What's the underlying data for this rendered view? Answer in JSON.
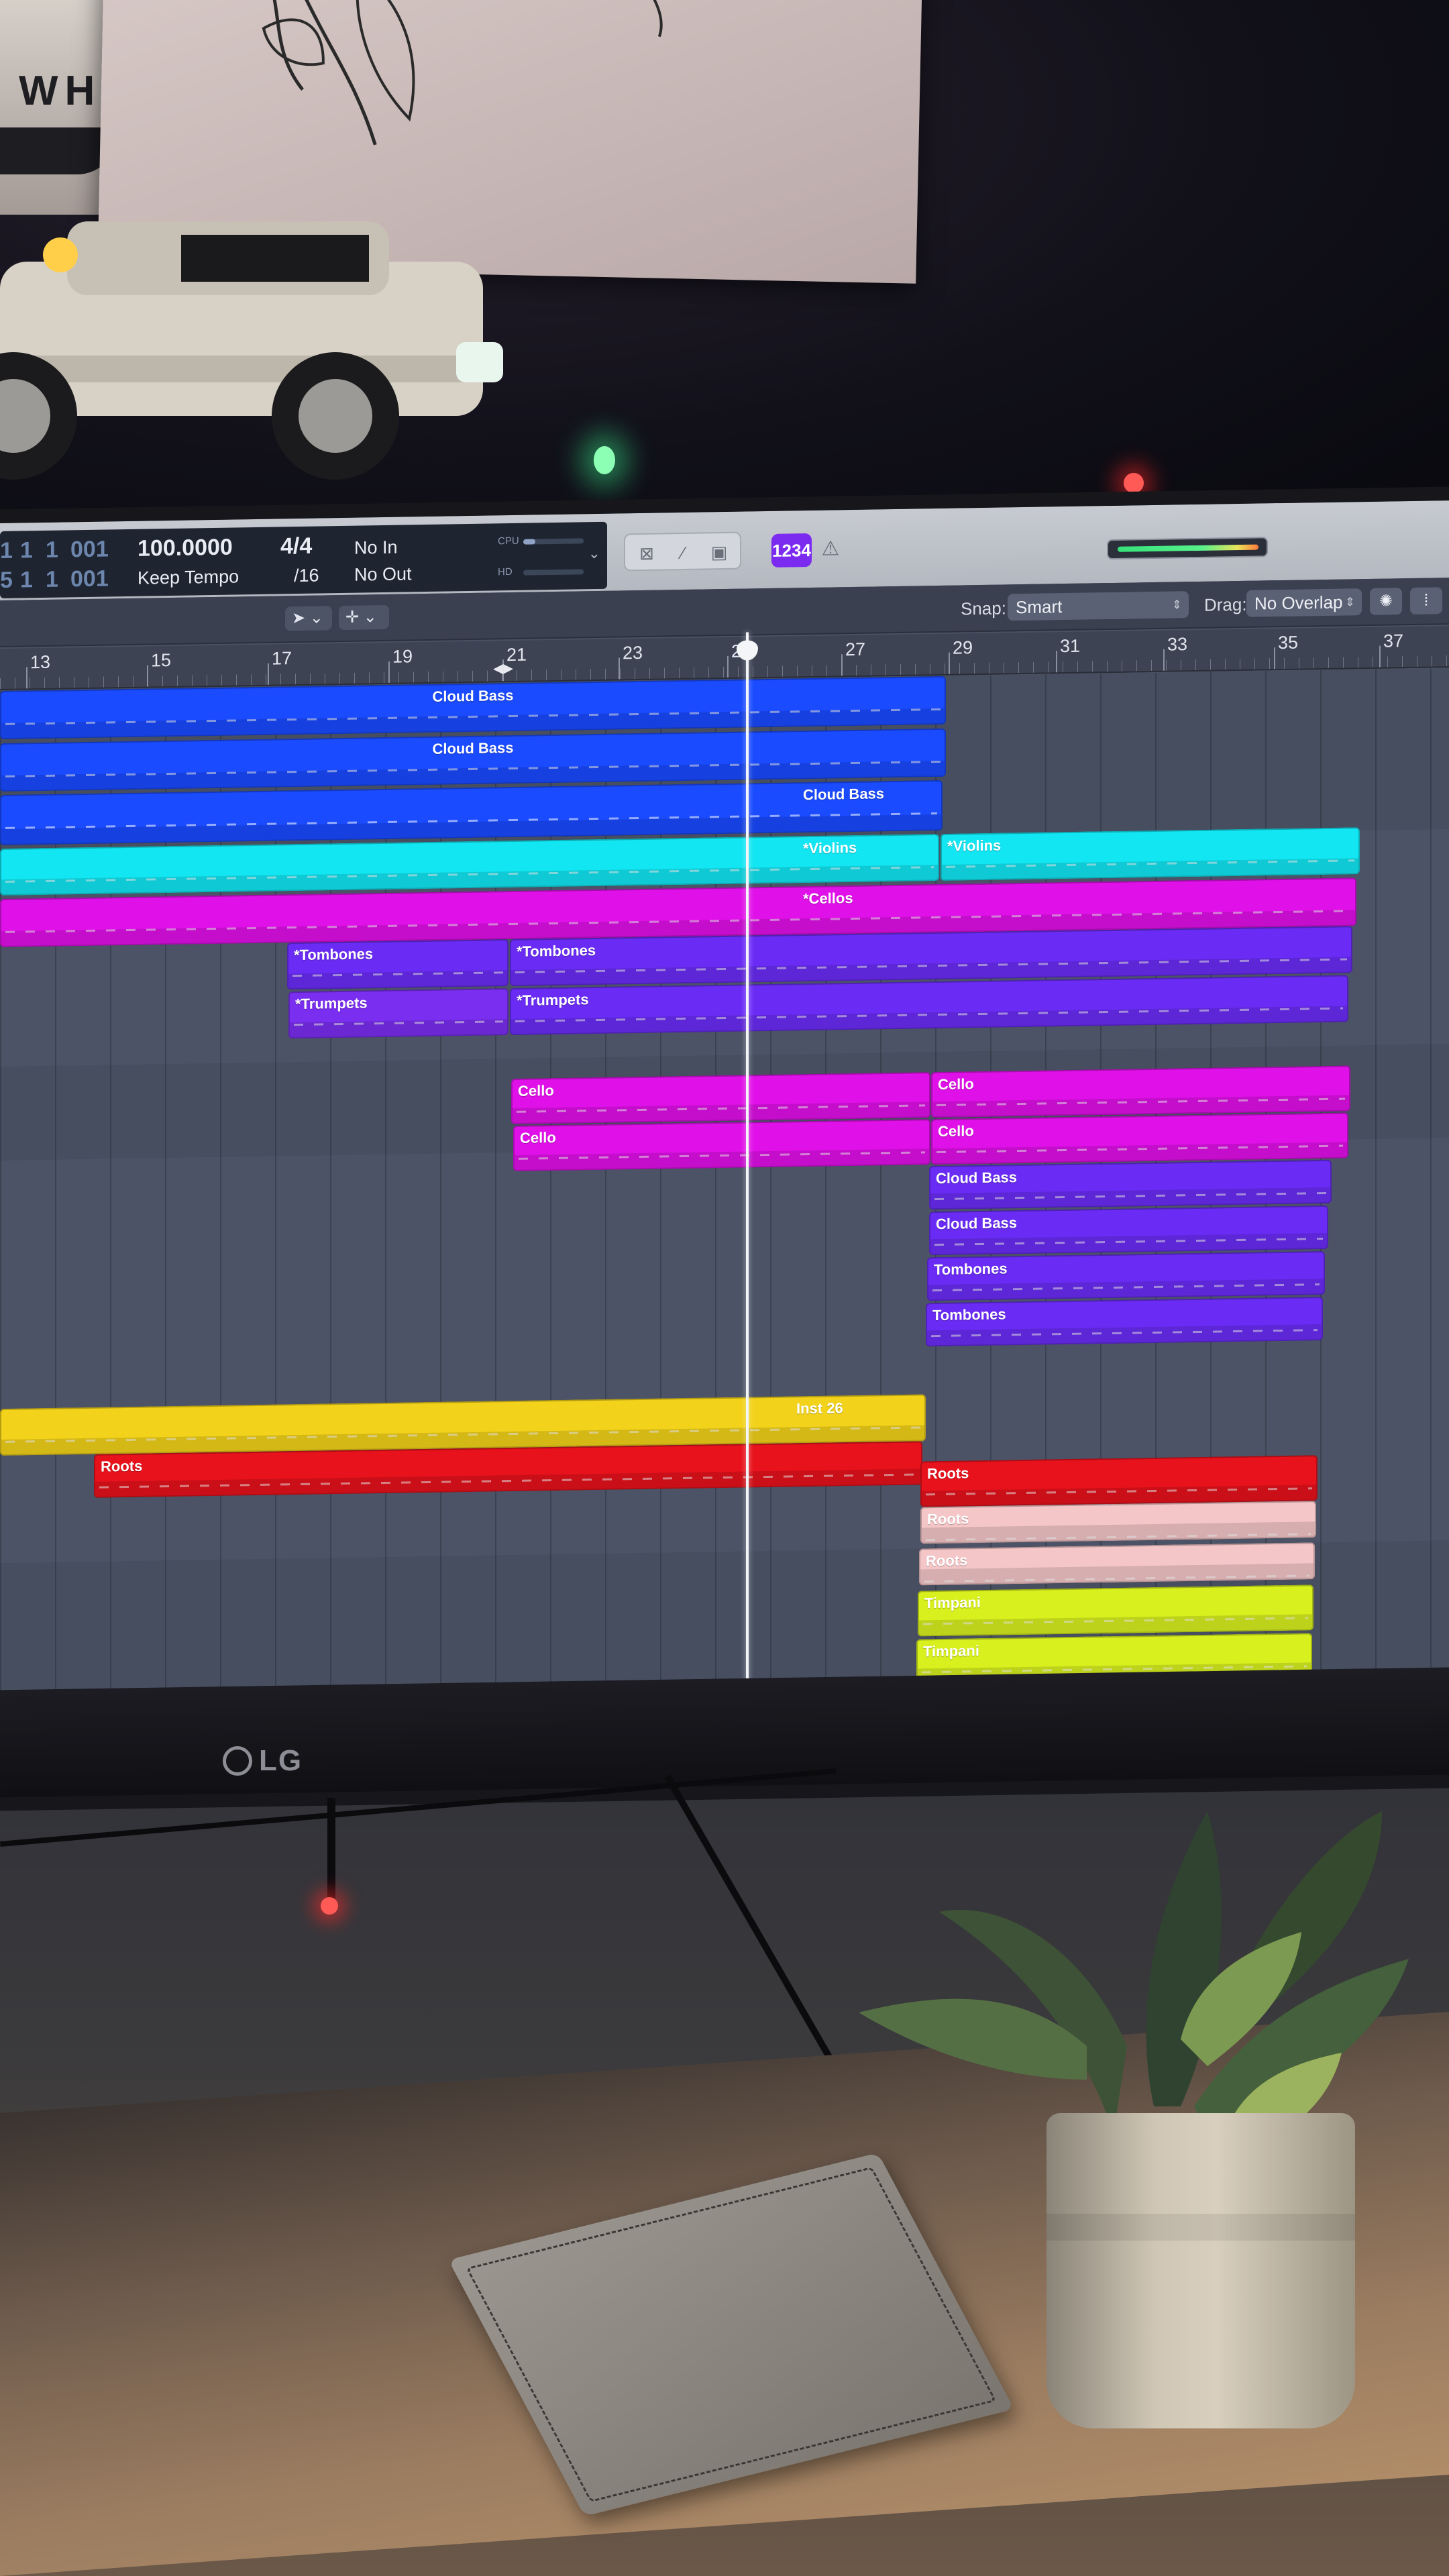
{
  "transport": {
    "position_bars": [
      "1",
      "1",
      "1",
      "001"
    ],
    "position_time": [
      "5",
      "1",
      "1",
      "001"
    ],
    "tempo": "100.0000",
    "tempo_mode": "Keep Tempo",
    "signature": "4/4",
    "division": "/16",
    "in_label": "No In",
    "out_label": "No Out",
    "cpu_label": "CPU",
    "hd_label": "HD",
    "count_in": "1234"
  },
  "toolbar": {
    "snap_label": "Snap:",
    "snap_value": "Smart",
    "drag_label": "Drag:",
    "drag_value": "No Overlap"
  },
  "ruler": {
    "bars": [
      "13",
      "15",
      "17",
      "19",
      "21",
      "23",
      "25",
      "27",
      "29",
      "31",
      "33",
      "35",
      "37"
    ]
  },
  "regions": [
    {
      "name": "Cloud Bass",
      "color": "#1a4bff"
    },
    {
      "name": "Cloud Bass",
      "color": "#1a4bff"
    },
    {
      "name": "Cloud Bass",
      "color": "#1a4bff"
    },
    {
      "name": "*Violins",
      "color": "#12e6f2"
    },
    {
      "name": "*Violins",
      "color": "#12e6f2"
    },
    {
      "name": "*Cellos",
      "color": "#e011e8"
    },
    {
      "name": "*Tombones",
      "color": "#6a2cf5"
    },
    {
      "name": "*Tombones",
      "color": "#6a2cf5"
    },
    {
      "name": "*Trumpets",
      "color": "#7a2ef0"
    },
    {
      "name": "*Trumpets",
      "color": "#6a2cf5"
    },
    {
      "name": "Cello",
      "color": "#e011e8"
    },
    {
      "name": "Cello",
      "color": "#e011e8"
    },
    {
      "name": "Cello",
      "color": "#e011e8"
    },
    {
      "name": "Cello",
      "color": "#e011e8"
    },
    {
      "name": "Cloud Bass",
      "color": "#6a2cf5"
    },
    {
      "name": "Cloud Bass",
      "color": "#6a2cf5"
    },
    {
      "name": "Tombones",
      "color": "#6a2cf5"
    },
    {
      "name": "Tombones",
      "color": "#6a2cf5"
    },
    {
      "name": "Inst 26",
      "color": "#f2d21a"
    },
    {
      "name": "Roots",
      "color": "#e8121c"
    },
    {
      "name": "Roots",
      "color": "#e8121c"
    },
    {
      "name": "Roots",
      "color": "#f5c6c8"
    },
    {
      "name": "Roots",
      "color": "#f5c6c8"
    },
    {
      "name": "Timpani",
      "color": "#d8f01e"
    },
    {
      "name": "Timpani",
      "color": "#d8f01e"
    }
  ],
  "monitor": {
    "brand": "LG"
  },
  "decor": {
    "box_text": "WH"
  }
}
